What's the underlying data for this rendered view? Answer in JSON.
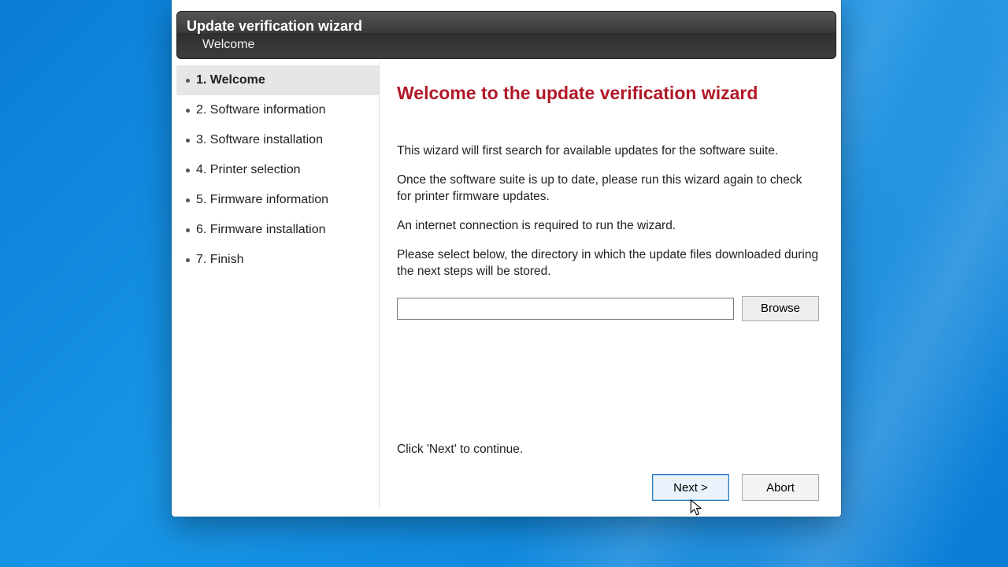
{
  "titlebar": {
    "title": "Update verification wizard",
    "subtitle": "Welcome"
  },
  "sidebar": {
    "steps": [
      {
        "label": "1. Welcome",
        "active": true
      },
      {
        "label": "2. Software information",
        "active": false
      },
      {
        "label": "3. Software installation",
        "active": false
      },
      {
        "label": "4. Printer selection",
        "active": false
      },
      {
        "label": "5. Firmware information",
        "active": false
      },
      {
        "label": "6. Firmware installation",
        "active": false
      },
      {
        "label": "7. Finish",
        "active": false
      }
    ]
  },
  "main": {
    "heading": "Welcome to the update verification wizard",
    "p1": "This wizard will first search for available updates for the software suite.",
    "p2": "Once the software suite is up to date, please run this wizard again to check for printer firmware updates.",
    "p3": "An internet connection is required to run the wizard.",
    "p4": "Please select below, the directory in which the update files downloaded during the next steps will be stored.",
    "path_value": "",
    "browse_label": "Browse",
    "continue_hint": "Click 'Next' to continue."
  },
  "footer": {
    "next_label": "Next >",
    "abort_label": "Abort"
  }
}
